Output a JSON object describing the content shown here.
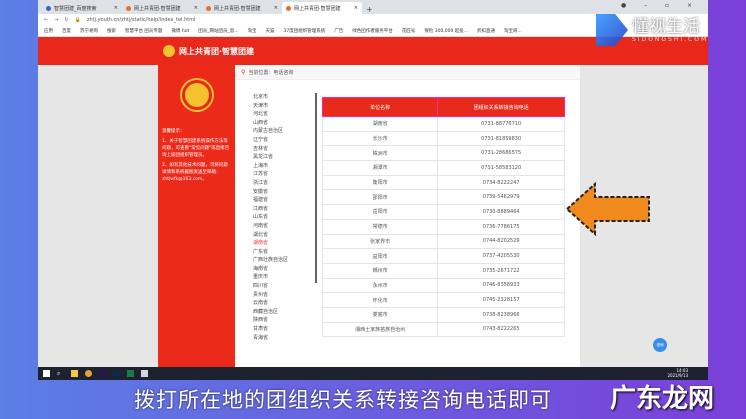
{
  "browser": {
    "tabs": [
      "智慧团建_百度搜索",
      "网上共青团·智慧团建",
      "网上共青团·智慧团建",
      "网上共青团·智慧团建"
    ],
    "url": "zhtj.youth.cn/zhtj/static/help/index_tel.html",
    "bookmarks": [
      "应用",
      "百度",
      "苏宁易购",
      "搜索",
      "智慧平台 团员专题",
      "微博 hot",
      "团员_网站团员_思...",
      "淘宝",
      "天猫",
      "37度团组织管理系统",
      "广告",
      "绿色团作者服务平台",
      "花匠号",
      "保险 300,000 起投...",
      "折扣直通",
      "淘宝商..."
    ]
  },
  "site": {
    "logo": "网上共青团·智慧团建",
    "breadcrumb": "当前位置：电话咨询",
    "tips_title": "温馨提示：",
    "tips": [
      "1、关于智慧团建系统操作方法等问题，可查看\"常见问题\"或直接咨询上级团组织管理员。",
      "2、如有其他技术问题，可将问题详情和系统截图发送至邮箱：zhtjwfk@163.com。"
    ],
    "provinces": [
      "北京市",
      "天津市",
      "河北省",
      "山西省",
      "内蒙古自治区",
      "辽宁省",
      "吉林省",
      "黑龙江省",
      "上海市",
      "江苏省",
      "浙江省",
      "安徽省",
      "福建省",
      "江西省",
      "山东省",
      "河南省",
      "湖北省",
      "湖南省",
      "广东省",
      "广西壮族自治区",
      "海南省",
      "重庆市",
      "四川省",
      "贵州省",
      "云南省",
      "西藏自治区",
      "陕西省",
      "甘肃省",
      "青海省"
    ],
    "selected_province": "湖南省",
    "table": {
      "headers": [
        "单位名称",
        "团组织关系转接咨询电话"
      ],
      "rows": [
        [
          "湖南省",
          "0731-88776710"
        ],
        [
          "长沙市",
          "0731-81859830"
        ],
        [
          "株洲市",
          "0731-28686575"
        ],
        [
          "湘潭市",
          "0731-58583120"
        ],
        [
          "衡阳市",
          "0734-8222247"
        ],
        [
          "邵阳市",
          "0739-5462979"
        ],
        [
          "岳阳市",
          "0730-8889464"
        ],
        [
          "常德市",
          "0736-7786175"
        ],
        [
          "张家界市",
          "0744-8202529"
        ],
        [
          "益阳市",
          "0737-4205530"
        ],
        [
          "郴州市",
          "0735-2671722"
        ],
        [
          "永州市",
          "0746-8358933"
        ],
        [
          "怀化市",
          "0745-2328157"
        ],
        [
          "娄底市",
          "0738-8238966"
        ],
        [
          "湘西土家族苗族自治州",
          "0743-8222265"
        ]
      ]
    },
    "float_button": "咨询"
  },
  "taskbar": {
    "time": "14:03",
    "date": "2021/9/13"
  },
  "subtitle": "拨打所在地的团组织关系转接咨询电话即可",
  "watermarks": {
    "top": "懂视生活",
    "top_sub": "SIDONGSHI.COM",
    "bottom": "广东龙网"
  },
  "colors": {
    "brand_red": "#e8281a",
    "arrow": "#f08a1c"
  }
}
